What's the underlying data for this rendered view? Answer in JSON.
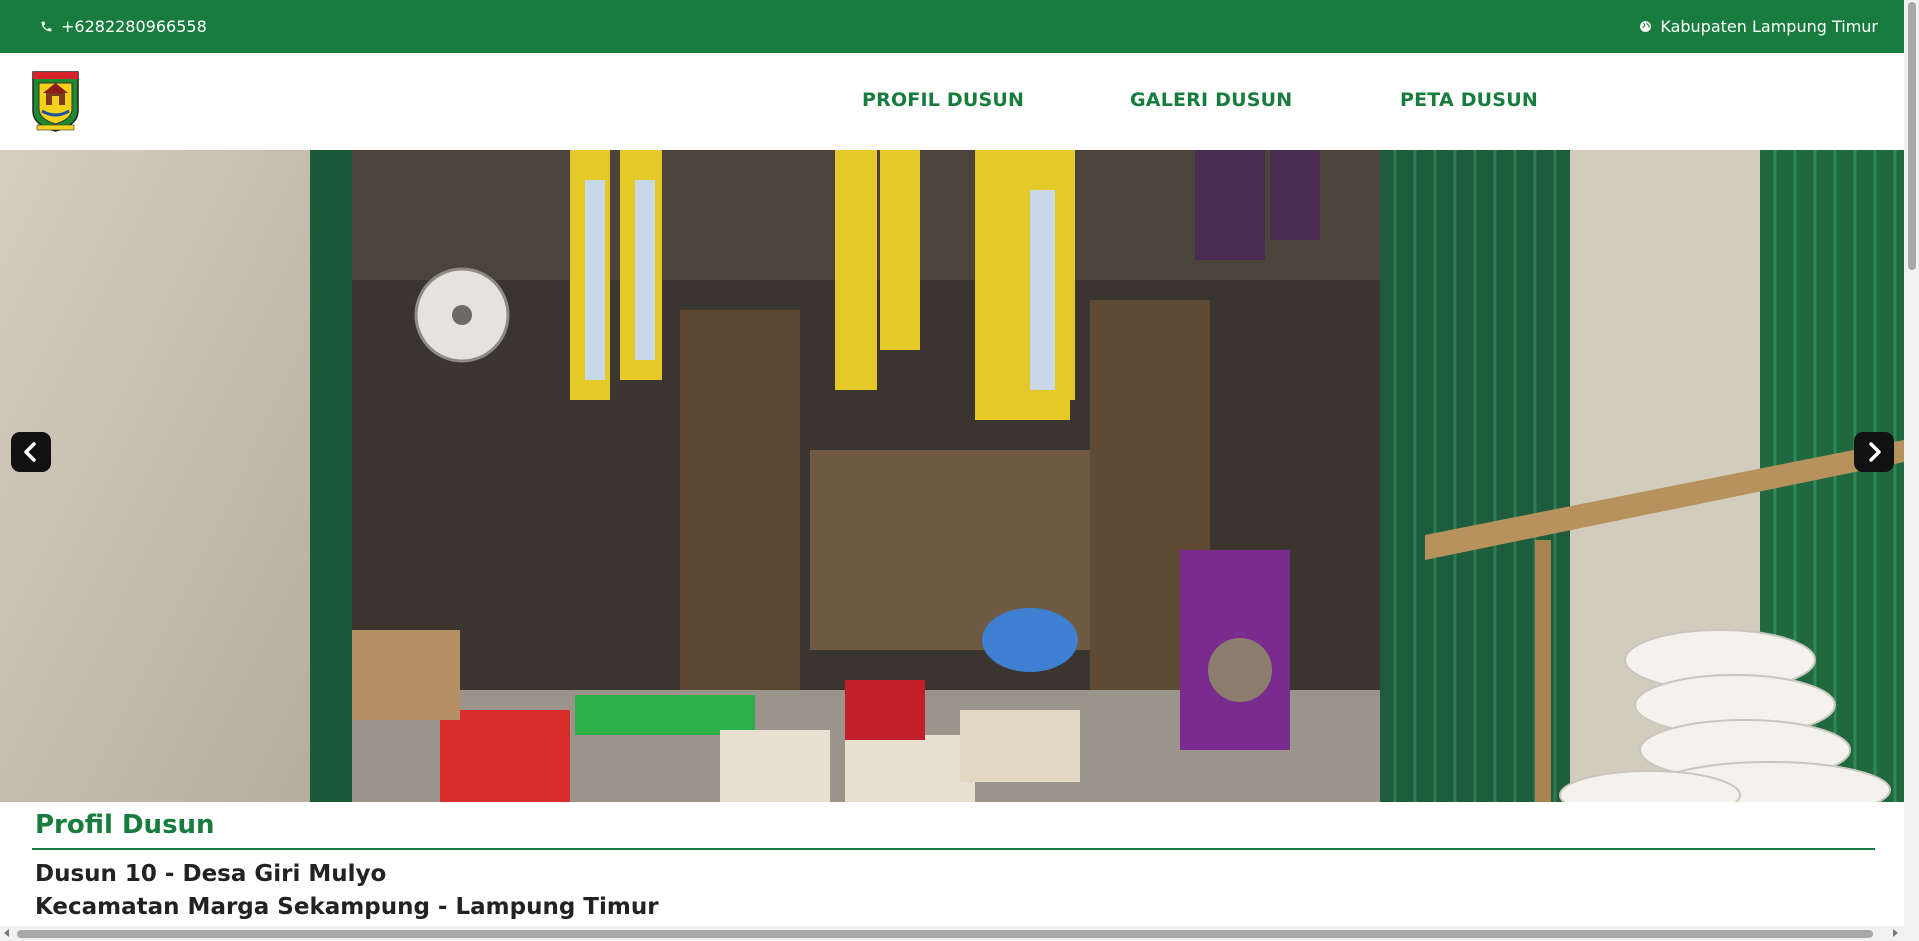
{
  "topbar": {
    "phone": "+6282280966558",
    "region": "Kabupaten Lampung Timur",
    "phone_icon": "phone-icon",
    "region_icon": "globe-icon",
    "background": "#177c3d"
  },
  "nav": {
    "logo_icon": "lampung-timur-emblem",
    "items": [
      "PROFIL DUSUN",
      "GALERI DUSUN",
      "PETA DUSUN"
    ],
    "color": "#177c3d"
  },
  "hero": {
    "image": "village-shop-storefront",
    "prev_icon": "chevron-left-icon",
    "next_icon": "chevron-right-icon"
  },
  "profile": {
    "title": "Profil Dusun",
    "line1": "Dusun 10 - Desa Giri Mulyo",
    "line2": "Kecamatan Marga Sekampung - Lampung Timur"
  }
}
